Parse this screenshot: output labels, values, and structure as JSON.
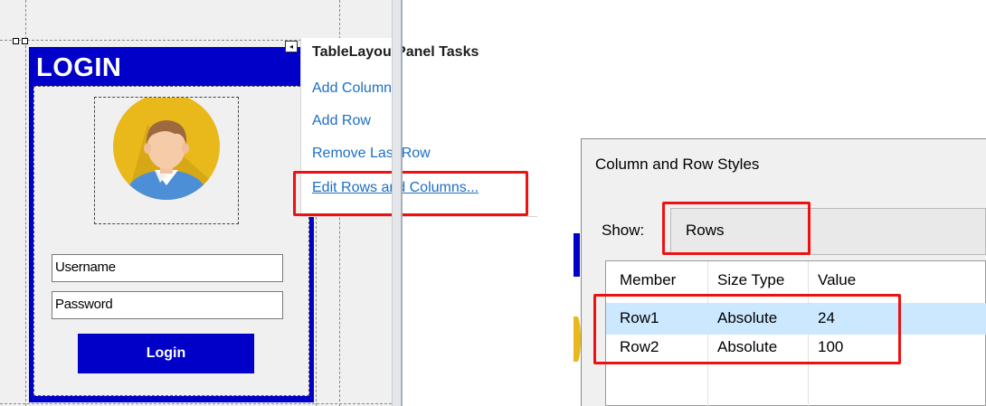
{
  "designer": {
    "form": {
      "title": "LOGIN",
      "username_value": "Username",
      "password_value": "Password",
      "login_button": "Login",
      "accent_color": "#0000c8",
      "avatar_icon": "user-avatar-icon"
    },
    "smart_tag_glyph": "◂",
    "task_panel": {
      "title": "TableLayoutPanel Tasks",
      "links": [
        {
          "label": "Add Column"
        },
        {
          "label": "Add Row"
        },
        {
          "label": "Remove Last Row"
        },
        {
          "label": "Edit Rows and Columns..."
        }
      ]
    }
  },
  "dialog": {
    "title": "Column and Row Styles",
    "show_label": "Show:",
    "show_value": "Rows",
    "columns": [
      "Member",
      "Size Type",
      "Value"
    ],
    "rows": [
      {
        "member": "Row1",
        "size_type": "Absolute",
        "value": "24",
        "selected": true
      },
      {
        "member": "Row2",
        "size_type": "Absolute",
        "value": "100",
        "selected": false
      }
    ]
  },
  "highlight_color": "#ee1111"
}
